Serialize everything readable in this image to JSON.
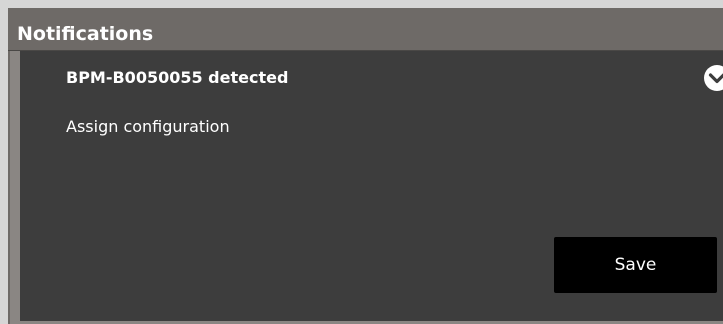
{
  "header": {
    "title": "Notifications"
  },
  "notification": {
    "title": "BPM-B0050055 detected",
    "message": "Assign configuration",
    "expand_icon": "chevron-down-circle-icon",
    "save_label": "Save"
  },
  "colors": {
    "header_bg": "#6e6a67",
    "card_bg": "#3d3d3d",
    "button_bg": "#000000",
    "text": "#ffffff"
  }
}
